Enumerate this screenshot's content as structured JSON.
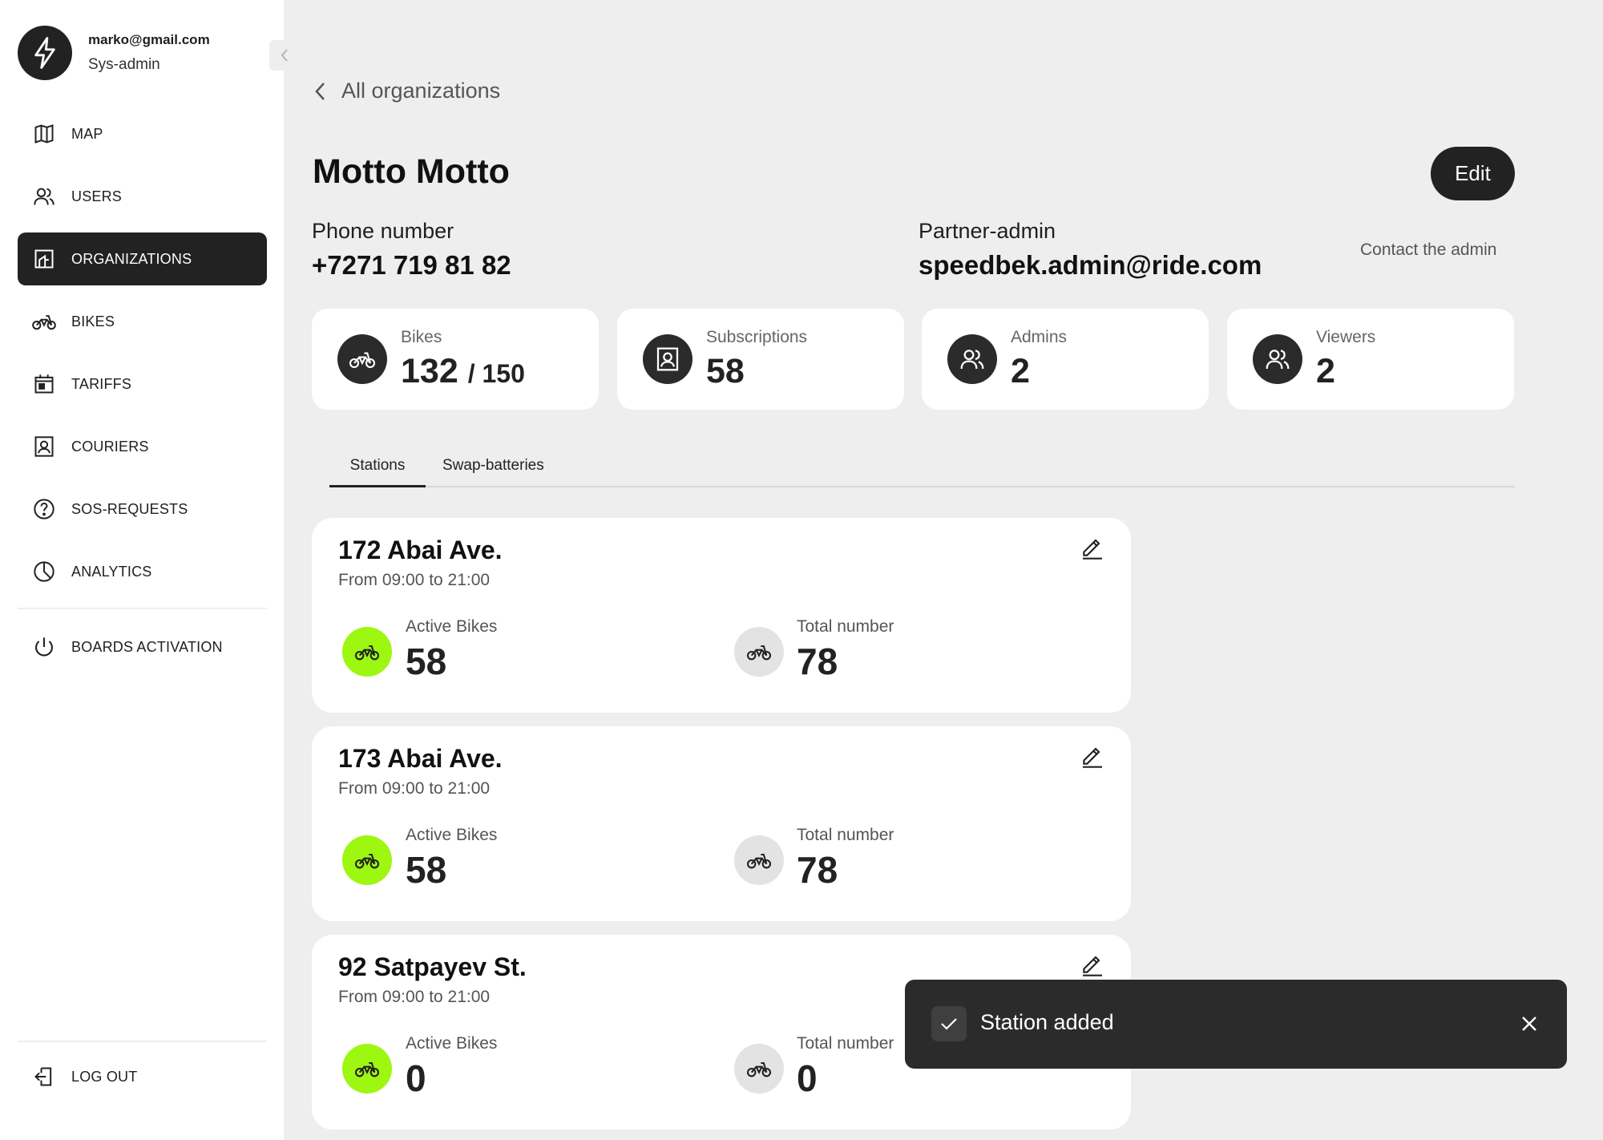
{
  "user": {
    "email": "marko@gmail.com",
    "role": "Sys-admin"
  },
  "nav": {
    "items": [
      {
        "label": "MAP",
        "icon": "map-icon"
      },
      {
        "label": "USERS",
        "icon": "users-icon"
      },
      {
        "label": "ORGANIZATIONS",
        "icon": "organizations-icon",
        "active": true
      },
      {
        "label": "BIKES",
        "icon": "bike-icon"
      },
      {
        "label": "TARIFFS",
        "icon": "calendar-icon"
      },
      {
        "label": "COURIERS",
        "icon": "courier-badge-icon"
      },
      {
        "label": "SOS-REQUESTS",
        "icon": "help-circle-icon"
      },
      {
        "label": "ANALYTICS",
        "icon": "pie-chart-icon"
      },
      {
        "label": "BOARDS ACTIVATION",
        "icon": "power-icon"
      }
    ],
    "logout": {
      "label": "LOG OUT",
      "icon": "logout-icon"
    }
  },
  "header": {
    "back_label": "All organizations",
    "title": "Motto Motto",
    "edit_label": "Edit"
  },
  "info": {
    "phone_label": "Phone number",
    "phone_value": "+7271 719 81 82",
    "admin_label": "Partner-admin",
    "admin_value": "speedbek.admin@ride.com",
    "contact_label": "Contact the admin"
  },
  "stats": {
    "bikes": {
      "label": "Bikes",
      "value": "132",
      "total": "/ 150"
    },
    "subscriptions": {
      "label": "Subscriptions",
      "value": "58"
    },
    "admins": {
      "label": "Admins",
      "value": "2"
    },
    "viewers": {
      "label": "Viewers",
      "value": "2"
    }
  },
  "tabs": [
    {
      "label": "Stations",
      "active": true
    },
    {
      "label": "Swap-batteries",
      "active": false
    }
  ],
  "stations": [
    {
      "name": "172 Abai Ave.",
      "hours": "From 09:00 to 21:00",
      "active_label": "Active Bikes",
      "active_value": "58",
      "total_label": "Total number",
      "total_value": "78"
    },
    {
      "name": "173 Abai Ave.",
      "hours": "From 09:00 to 21:00",
      "active_label": "Active Bikes",
      "active_value": "58",
      "total_label": "Total number",
      "total_value": "78"
    },
    {
      "name": "92 Satpayev St.",
      "hours": "From 09:00 to 21:00",
      "active_label": "Active Bikes",
      "active_value": "0",
      "total_label": "Total number",
      "total_value": "0"
    }
  ],
  "toast": {
    "message": "Station added"
  },
  "colors": {
    "accent": "#9ef711",
    "dark": "#222222",
    "background": "#eeeeee"
  }
}
